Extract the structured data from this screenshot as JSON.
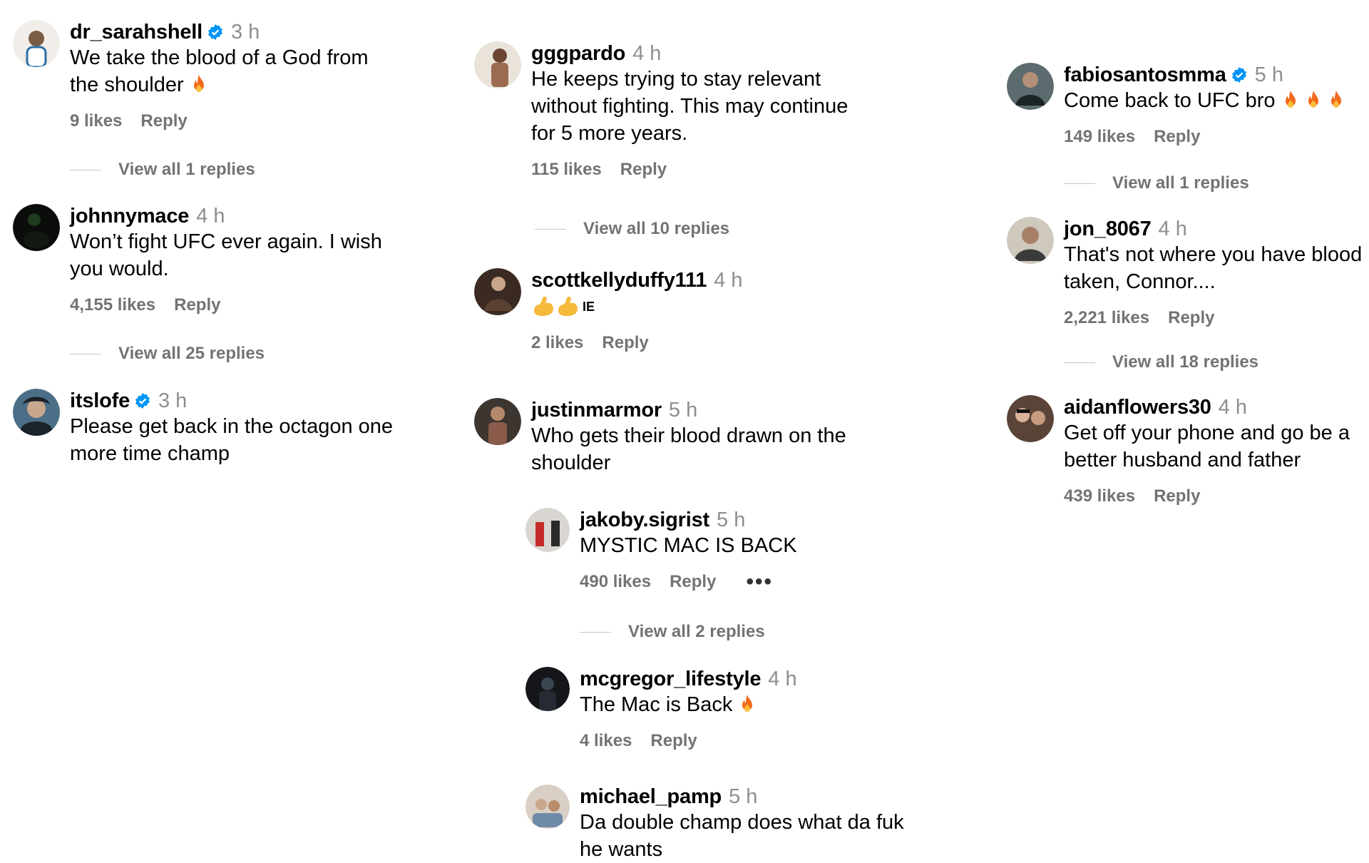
{
  "columns": [
    {
      "comments": [
        {
          "username": "dr_sarahshell",
          "verified": true,
          "time": "3 h",
          "text": [
            "We take the blood of a God from",
            "the shoulder"
          ],
          "fire": 1,
          "likes": "9 likes",
          "reply": "Reply",
          "view_replies": "View all 1 replies",
          "avatar_colors": [
            "#f1ede8",
            "#2b6fa8"
          ]
        },
        {
          "username": "johnnymace",
          "verified": false,
          "time": "4 h",
          "text": [
            "Won’t fight UFC ever again. I wish",
            "you would."
          ],
          "fire": 0,
          "likes": "4,155 likes",
          "reply": "Reply",
          "view_replies": "View all 25 replies",
          "avatar_colors": [
            "#0a0d0a",
            "#1f3a1c"
          ]
        },
        {
          "username": "itslofe",
          "verified": true,
          "time": "3 h",
          "text": [
            "Please get back in the octagon one",
            "more time champ"
          ],
          "fire": 0,
          "likes": "",
          "reply": "",
          "view_replies": "",
          "avatar_colors": [
            "#4b6f86",
            "#1b2229"
          ]
        }
      ]
    },
    {
      "comments": [
        {
          "username": "gggpardo",
          "verified": false,
          "time": "4 h",
          "text": [
            "He keeps trying to stay relevant",
            "without fighting. This may continue",
            "for 5 more years."
          ],
          "fire": 0,
          "likes": "115 likes",
          "reply": "Reply",
          "view_replies": "View all 10 replies",
          "avatar_colors": [
            "#e9e3da",
            "#9b6a4f"
          ]
        },
        {
          "username": "scottkellyduffy111",
          "verified": false,
          "time": "4 h",
          "text": [
            "IE"
          ],
          "emoji_strong": 2,
          "fire": 0,
          "likes": "2 likes",
          "reply": "Reply",
          "view_replies": "",
          "avatar_colors": [
            "#3b2a22",
            "#c9a68b"
          ]
        },
        {
          "username": "justinmarmor",
          "verified": false,
          "time": "5 h",
          "text": [
            "Who gets their blood drawn on the",
            "shoulder"
          ],
          "fire": 0,
          "likes": "",
          "reply": "",
          "view_replies": "",
          "avatar_colors": [
            "#3c3530",
            "#8a5a4a"
          ]
        }
      ],
      "replies": [
        {
          "username": "jakoby.sigrist",
          "verified": false,
          "time": "5 h",
          "text": [
            "MYSTIC MAC IS BACK"
          ],
          "fire": 0,
          "likes": "490 likes",
          "reply": "Reply",
          "more": "•••",
          "view_replies": "View all 2 replies",
          "avatar_colors": [
            "#d9d6d2",
            "#c62b2b"
          ]
        },
        {
          "username": "mcgregor_lifestyle",
          "verified": false,
          "time": "4 h",
          "text": [
            "The Mac is Back"
          ],
          "fire": 1,
          "likes": "4 likes",
          "reply": "Reply",
          "view_replies": "",
          "avatar_colors": [
            "#14161a",
            "#3b4552"
          ]
        },
        {
          "username": "michael_pamp",
          "verified": false,
          "time": "5 h",
          "text": [
            "Da double champ does what da fuk",
            "he wants"
          ],
          "fire": 0,
          "likes": "",
          "reply": "",
          "view_replies": "",
          "avatar_colors": [
            "#d9cfc4",
            "#6e8aa6"
          ]
        }
      ]
    },
    {
      "comments": [
        {
          "username": "fabiosantosmma",
          "verified": true,
          "time": "5 h",
          "text": [
            "Come back to UFC bro"
          ],
          "fire": 3,
          "likes": "149 likes",
          "reply": "Reply",
          "view_replies": "View all 1 replies",
          "avatar_colors": [
            "#1d2426",
            "#5c6b6e"
          ]
        },
        {
          "username": "jon_8067",
          "verified": false,
          "time": "4 h",
          "text": [
            "That's not where you have blood",
            "taken, Connor...."
          ],
          "fire": 0,
          "likes": "2,221 likes",
          "reply": "Reply",
          "view_replies": "View all 18 replies",
          "avatar_colors": [
            "#cfc8bd",
            "#3a3a3a"
          ]
        },
        {
          "username": "aidanflowers30",
          "verified": false,
          "time": "4 h",
          "text": [
            "Get off your phone and go be a",
            "better husband and father"
          ],
          "fire": 0,
          "likes": "439 likes",
          "reply": "Reply",
          "view_replies": "",
          "avatar_colors": [
            "#5a4438",
            "#d8b39a"
          ]
        }
      ]
    }
  ]
}
